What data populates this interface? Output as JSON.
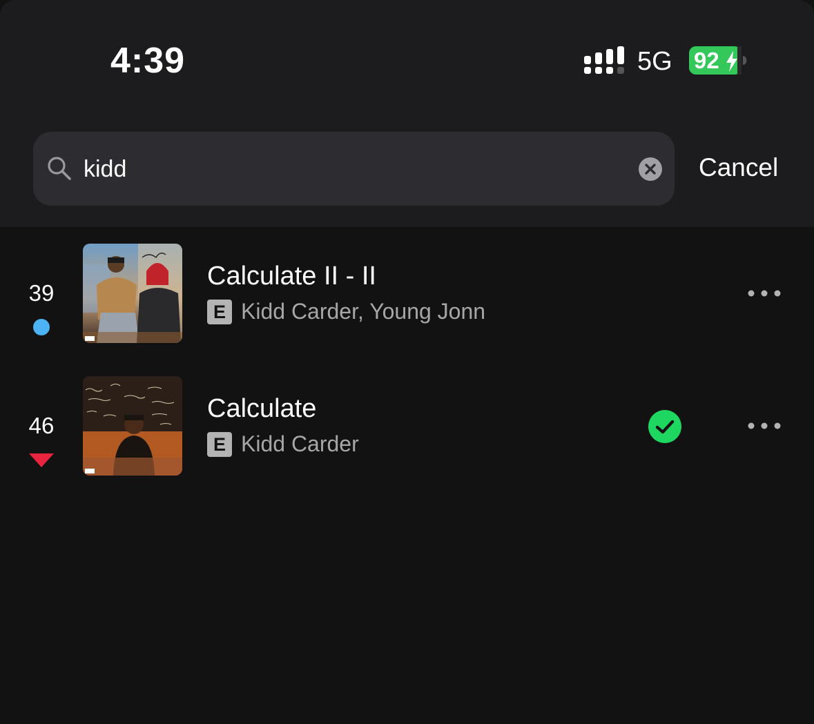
{
  "status_bar": {
    "time": "4:39",
    "network": "5G",
    "battery": "92"
  },
  "search": {
    "value": "kidd",
    "cancel_label": "Cancel"
  },
  "results": [
    {
      "rank": "39",
      "indicator": "new",
      "indicator_color": "#4cb3f5",
      "title": "Calculate II - II",
      "explicit": "E",
      "artists": "Kidd Carder, Young Jonn",
      "downloaded": false
    },
    {
      "rank": "46",
      "indicator": "down",
      "indicator_color": "#e8243f",
      "title": "Calculate",
      "explicit": "E",
      "artists": "Kidd Carder",
      "downloaded": true
    }
  ],
  "colors": {
    "accent_green": "#1ed760",
    "battery_green": "#34c759"
  }
}
